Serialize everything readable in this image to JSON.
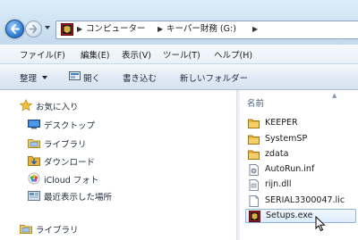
{
  "address_bar": {
    "crumbs": [
      "コンピューター",
      "キーパー財務 (G:)"
    ]
  },
  "menu": {
    "items": [
      "ファイル(F)",
      "編集(E)",
      "表示(V)",
      "ツール(T)",
      "ヘルプ(H)"
    ]
  },
  "command_bar": {
    "organize": "整理",
    "open": "開く",
    "burn": "書き込む",
    "new_folder": "新しいフォルダー"
  },
  "nav_pane": {
    "items": [
      {
        "label": "お気に入り",
        "icon": "star-icon"
      },
      {
        "label": "デスクトップ",
        "icon": "desktop-icon"
      },
      {
        "label": "ライブラリ",
        "icon": "library-icon"
      },
      {
        "label": "ダウンロード",
        "icon": "downloads-icon"
      },
      {
        "label": "iCloud フォト",
        "icon": "icloud-photos-icon"
      },
      {
        "label": "最近表示した場所",
        "icon": "recent-places-icon"
      },
      {
        "label": "ライブラリ",
        "icon": "library-icon"
      }
    ]
  },
  "file_pane": {
    "column_header": "名前",
    "files": [
      {
        "name": "KEEPER",
        "icon": "folder-icon"
      },
      {
        "name": "SystemSP",
        "icon": "folder-icon"
      },
      {
        "name": "zdata",
        "icon": "folder-icon"
      },
      {
        "name": "AutoRun.inf",
        "icon": "settings-file-icon"
      },
      {
        "name": "rijn.dll",
        "icon": "dll-file-icon"
      },
      {
        "name": "SERIAL3300047.lic",
        "icon": "document-icon"
      },
      {
        "name": "Setups.exe",
        "icon": "setup-exe-icon",
        "selected": true
      }
    ]
  },
  "colors": {
    "selection_border": "#8fb5e2",
    "folder": "#e8b23a",
    "accent_blue": "#3b86d9"
  }
}
